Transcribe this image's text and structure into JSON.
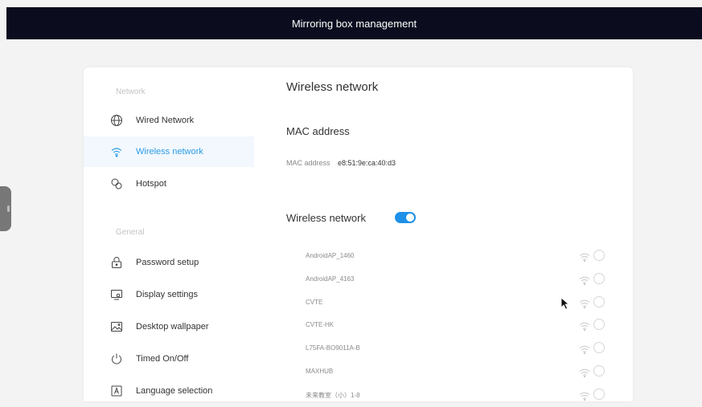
{
  "header": {
    "title": "Mirroring box management"
  },
  "sidebar": {
    "sections": [
      {
        "label": "Network"
      },
      {
        "label": "General"
      }
    ],
    "items": [
      {
        "label": "Wired Network",
        "icon": "globe-icon"
      },
      {
        "label": "Wireless network",
        "icon": "wifi-icon",
        "active": true
      },
      {
        "label": "Hotspot",
        "icon": "hotspot-icon"
      },
      {
        "label": "Password setup",
        "icon": "lock-icon"
      },
      {
        "label": "Display settings",
        "icon": "display-icon"
      },
      {
        "label": "Desktop wallpaper",
        "icon": "wallpaper-icon"
      },
      {
        "label": "Timed On/Off",
        "icon": "power-icon"
      },
      {
        "label": "Language selection",
        "icon": "language-icon"
      }
    ]
  },
  "main": {
    "title": "Wireless network",
    "mac_section": "MAC address",
    "mac_label": "MAC address",
    "mac_value": "e8:51:9e:ca:40:d3",
    "wifi_label": "Wireless network",
    "wifi_enabled": true,
    "networks": [
      {
        "name": "AndroidAP_1460"
      },
      {
        "name": "AndroidAP_4163"
      },
      {
        "name": "CVTE"
      },
      {
        "name": "CVTE-HK"
      },
      {
        "name": "L75FA-BO9011A-B"
      },
      {
        "name": "MAXHUB"
      },
      {
        "name": "未来教室（小）1-8"
      }
    ]
  },
  "colors": {
    "header_bg": "#0b0d1f",
    "accent": "#1e90e8",
    "active_bg": "#f2f8fd"
  }
}
